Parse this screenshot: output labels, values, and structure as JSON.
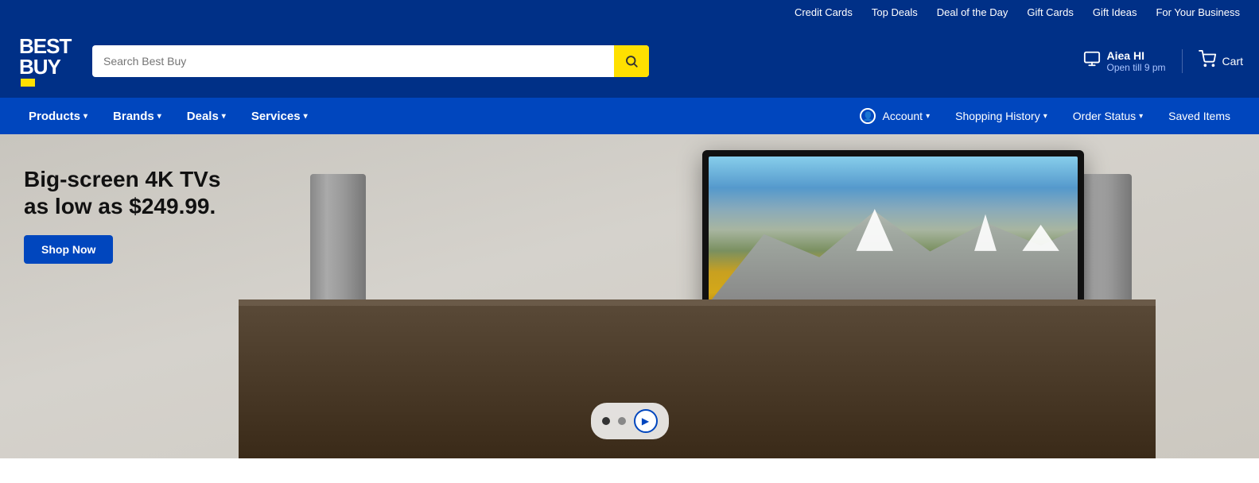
{
  "utility_bar": {
    "links": [
      {
        "id": "credit-cards",
        "label": "Credit Cards"
      },
      {
        "id": "top-deals",
        "label": "Top Deals"
      },
      {
        "id": "deal-of-the-day",
        "label": "Deal of the Day"
      },
      {
        "id": "gift-cards",
        "label": "Gift Cards"
      },
      {
        "id": "gift-ideas",
        "label": "Gift Ideas"
      },
      {
        "id": "for-your-business",
        "label": "For Your Business"
      }
    ]
  },
  "header": {
    "logo_line1": "BEST",
    "logo_line2": "BUY",
    "search_placeholder": "Search Best Buy",
    "store_name": "Aiea HI",
    "store_hours": "Open till 9 pm",
    "cart_label": "Cart"
  },
  "nav": {
    "left_items": [
      {
        "id": "products",
        "label": "Products",
        "has_dropdown": true
      },
      {
        "id": "brands",
        "label": "Brands",
        "has_dropdown": true
      },
      {
        "id": "deals",
        "label": "Deals",
        "has_dropdown": true
      },
      {
        "id": "services",
        "label": "Services",
        "has_dropdown": true
      }
    ],
    "right_items": [
      {
        "id": "account",
        "label": "Account",
        "has_dropdown": true,
        "has_icon": true
      },
      {
        "id": "shopping-history",
        "label": "Shopping History",
        "has_dropdown": true
      },
      {
        "id": "order-status",
        "label": "Order Status",
        "has_dropdown": true
      },
      {
        "id": "saved-items",
        "label": "Saved Items",
        "has_dropdown": false
      }
    ]
  },
  "hero": {
    "headline": "Big-screen 4K TVs as low as $249.99.",
    "cta_label": "Shop Now",
    "carousel": {
      "dots": [
        {
          "id": "dot1",
          "active": true
        },
        {
          "id": "dot2",
          "active": false
        },
        {
          "id": "dot3",
          "active": false
        }
      ],
      "play_label": "▶"
    }
  }
}
